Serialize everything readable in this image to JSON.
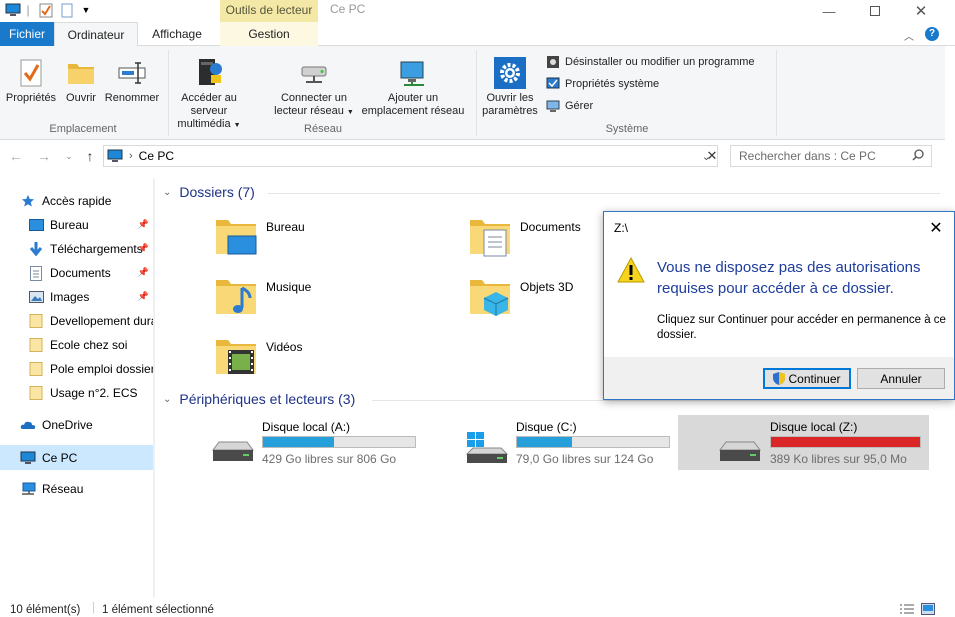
{
  "window": {
    "title": "Ce PC",
    "context_tab": "Outils de lecteur"
  },
  "ribbon_tabs": {
    "fichier": "Fichier",
    "ordinateur": "Ordinateur",
    "affichage": "Affichage",
    "gestion": "Gestion"
  },
  "ribbon": {
    "emplacement": {
      "label": "Emplacement",
      "proprietes": "Propriétés",
      "ouvrir": "Ouvrir",
      "renommer": "Renommer"
    },
    "reseau": {
      "label": "Réseau",
      "media_1": "Accéder au serveur",
      "media_2": "multimédia",
      "connect_1": "Connecter un",
      "connect_2": "lecteur réseau",
      "add_1": "Ajouter un",
      "add_2": "emplacement réseau"
    },
    "systeme": {
      "label": "Système",
      "settings_1": "Ouvrir les",
      "settings_2": "paramètres",
      "uninstall": "Désinstaller ou modifier un programme",
      "sysprops": "Propriétés système",
      "manage": "Gérer"
    }
  },
  "address": {
    "path": "Ce PC",
    "search_placeholder": "Rechercher dans : Ce PC"
  },
  "nav": {
    "quick_access": "Accès rapide",
    "items": [
      {
        "label": "Bureau",
        "icon": "desktop-icon",
        "pinned": true
      },
      {
        "label": "Téléchargements",
        "icon": "download-icon",
        "pinned": true
      },
      {
        "label": "Documents",
        "icon": "documents-icon",
        "pinned": true
      },
      {
        "label": "Images",
        "icon": "images-icon",
        "pinned": true
      },
      {
        "label": "Devellopement dura",
        "icon": "folder-icon",
        "pinned": false
      },
      {
        "label": "Ecole chez soi",
        "icon": "folder-icon",
        "pinned": false
      },
      {
        "label": "Pole emploi dossier",
        "icon": "folder-icon",
        "pinned": false
      },
      {
        "label": "Usage n°2. ECS",
        "icon": "folder-icon",
        "pinned": false
      }
    ],
    "onedrive": "OneDrive",
    "this_pc": "Ce PC",
    "network": "Réseau"
  },
  "folders": {
    "header": "Dossiers (7)",
    "items": [
      {
        "label": "Bureau",
        "icon": "desktop-folder-icon"
      },
      {
        "label": "Documents",
        "icon": "documents-folder-icon"
      },
      {
        "label": "Musique",
        "icon": "music-folder-icon"
      },
      {
        "label": "Objets 3D",
        "icon": "3d-objects-folder-icon"
      },
      {
        "label": "Vidéos",
        "icon": "videos-folder-icon"
      }
    ]
  },
  "drives": {
    "header": "Périphériques et lecteurs (3)",
    "items": [
      {
        "label": "Disque local (A:)",
        "free": "429 Go libres sur 806 Go",
        "used_fraction": 0.47,
        "color": "#26a0da"
      },
      {
        "label": "Disque  (C:)",
        "free": "79,0 Go libres sur 124 Go",
        "used_fraction": 0.36,
        "color": "#26a0da"
      },
      {
        "label": "Disque local (Z:)",
        "free": "389 Ko libres sur 95,0 Mo",
        "used_fraction": 1.0,
        "color": "#da2626"
      }
    ]
  },
  "dialog": {
    "title": "Z:\\",
    "message": "Vous ne disposez pas des autorisations requises pour accéder à ce dossier.",
    "sub": "Cliquez sur Continuer pour accéder en permanence à ce dossier.",
    "continue": "Continuer",
    "cancel": "Annuler"
  },
  "status": {
    "count": "10 élément(s)",
    "selected": "1 élément sélectionné"
  }
}
